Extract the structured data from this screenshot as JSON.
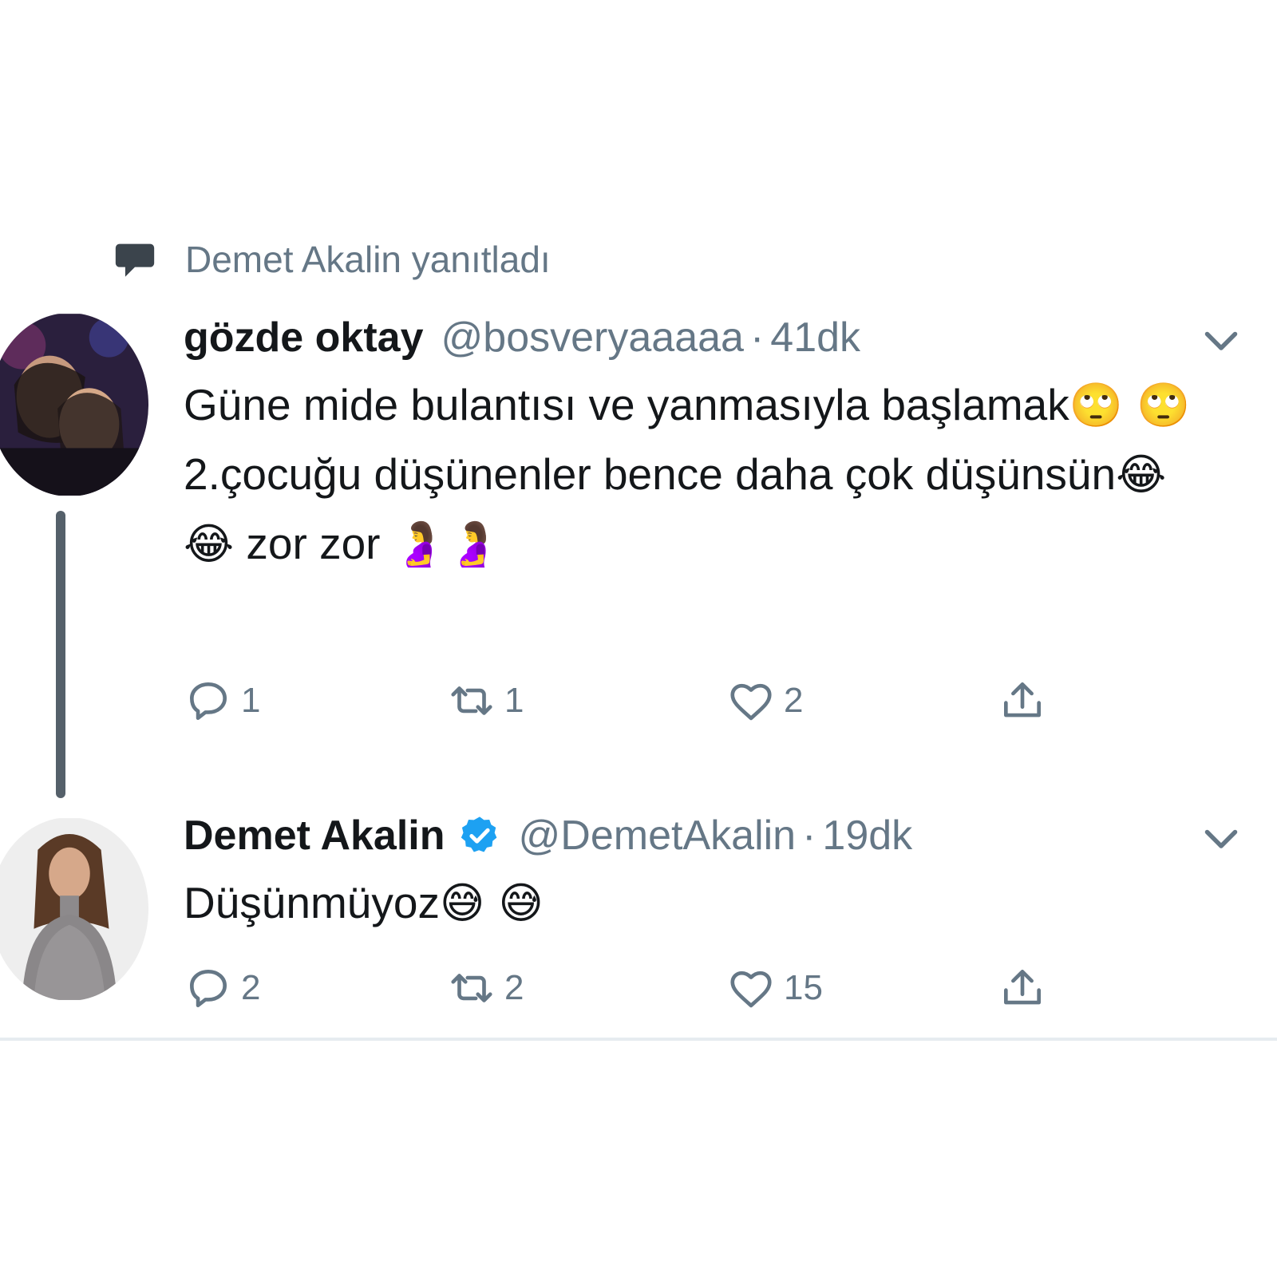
{
  "context": {
    "icon": "speech-bubble-icon",
    "text": "Demet Akalin yanıtladı"
  },
  "tweets": [
    {
      "name": "gözde oktay",
      "handle": "@bosveryaaaaa",
      "dot": "·",
      "time": "41dk",
      "verified": false,
      "text_parts": [
        "Güne mide bulantısı ve yanmasıyla başlamak",
        "🙄 🙄",
        " 2.çocuğu düşünenler bence daha çok düşünsün",
        "😂 😂",
        " zor zor ",
        "🤰🤰"
      ],
      "actions": {
        "replies": "1",
        "retweets": "1",
        "likes": "2"
      }
    },
    {
      "name": "Demet Akalin",
      "handle": "@DemetAkalin",
      "dot": "·",
      "time": "19dk",
      "verified": true,
      "text_parts": [
        "Düşünmüyoz",
        "😅 😅"
      ],
      "actions": {
        "replies": "2",
        "retweets": "2",
        "likes": "15"
      }
    }
  ],
  "colors": {
    "text": "#14171a",
    "muted": "#657786",
    "verified_badge": "#1da1f2",
    "divider": "#e6ecf0"
  }
}
